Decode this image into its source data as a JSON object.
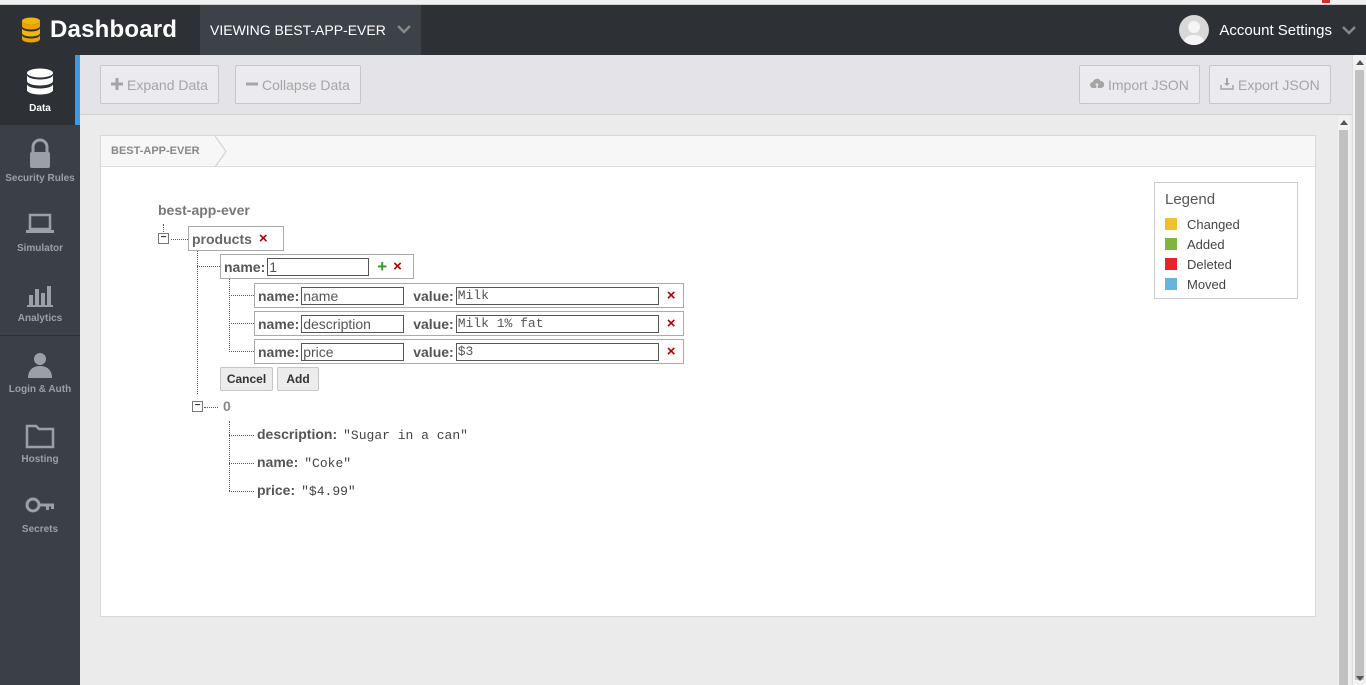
{
  "header": {
    "brand": "Dashboard",
    "viewing": "VIEWING BEST-APP-EVER",
    "account": "Account Settings"
  },
  "sidebar": {
    "items": [
      {
        "label": "Data",
        "icon": "database-icon"
      },
      {
        "label": "Security Rules",
        "icon": "lock-icon"
      },
      {
        "label": "Simulator",
        "icon": "laptop-icon"
      },
      {
        "label": "Analytics",
        "icon": "bar-chart-icon"
      },
      {
        "label": "Login & Auth",
        "icon": "user-icon"
      },
      {
        "label": "Hosting",
        "icon": "folder-icon"
      },
      {
        "label": "Secrets",
        "icon": "key-icon"
      }
    ]
  },
  "toolbar": {
    "expand": "Expand Data",
    "collapse": "Collapse Data",
    "import": "Import JSON",
    "export": "Export JSON"
  },
  "breadcrumb": "BEST-APP-EVER",
  "tree": {
    "root": "best-app-ever",
    "products": "products",
    "new_child": {
      "name_label": "name:",
      "name_value": "1",
      "fields": [
        {
          "name_label": "name:",
          "name": "name",
          "value_label": "value:",
          "value": "Milk"
        },
        {
          "name_label": "name:",
          "name": "description",
          "value_label": "value:",
          "value": "Milk 1% fat"
        },
        {
          "name_label": "name:",
          "name": "price",
          "value_label": "value:",
          "value": "$3"
        }
      ],
      "cancel": "Cancel",
      "add": "Add"
    },
    "existing": {
      "key": "0",
      "children": [
        {
          "key": "description:",
          "value": "\"Sugar in a can\""
        },
        {
          "key": "name:",
          "value": "\"Coke\""
        },
        {
          "key": "price:",
          "value": "\"$4.99\""
        }
      ]
    },
    "toggle_symbol": "−",
    "delete_symbol": "×",
    "add_symbol": "+"
  },
  "legend": {
    "title": "Legend",
    "items": [
      {
        "label": "Changed",
        "color": "#f2bd2e"
      },
      {
        "label": "Added",
        "color": "#7fb53c"
      },
      {
        "label": "Deleted",
        "color": "#e8242a"
      },
      {
        "label": "Moved",
        "color": "#68b4de"
      }
    ]
  },
  "colors": {
    "header_bg": "#2d3136",
    "sidebar_bg": "#3b4046",
    "accent": "#3a9ae8",
    "delete_red": "#b30000",
    "add_green": "#2a9d28"
  }
}
